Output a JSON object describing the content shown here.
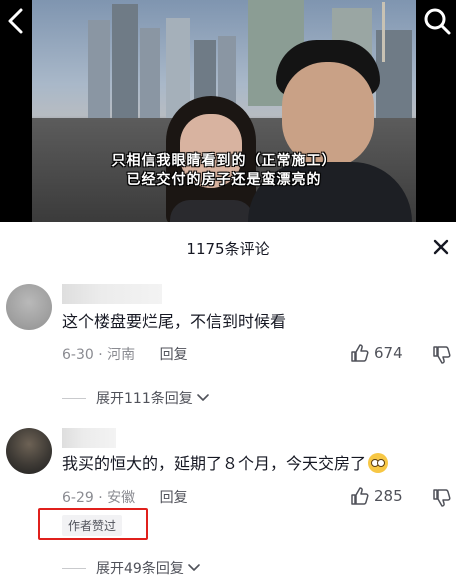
{
  "video": {
    "caption_line1": "只相信我眼睛看到的（正常施工）",
    "caption_line2": "已经交付的房子还是蛮漂亮的"
  },
  "icons": {
    "back": "chevron-left-icon",
    "search": "search-icon",
    "close": "close-icon",
    "like": "thumbs-up-icon",
    "dislike": "thumbs-down-icon",
    "expand": "chevron-down-icon"
  },
  "panel": {
    "title": "1175条评论"
  },
  "comments": [
    {
      "text": "这个楼盘要烂尾，不信到时候看",
      "date": "6-30",
      "location": "河南",
      "reply_label": "回复",
      "likes": "674",
      "expand_label": "展开111条回复"
    },
    {
      "text": "我买的恒大的，延期了８个月，今天交房了",
      "date": "6-29",
      "location": "安徽",
      "reply_label": "回复",
      "likes": "285",
      "author_liked": "作者赞过",
      "expand_label": "展开49条回复"
    }
  ],
  "colors": {
    "highlight": "#e0201c",
    "secondary_text": "#8a8b91"
  }
}
